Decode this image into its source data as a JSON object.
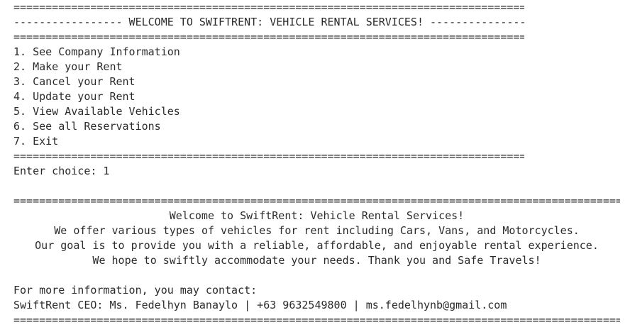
{
  "console": {
    "menu_rule": "================================================================================",
    "menu_title": "----------------- WELCOME TO SWIFTRENT: VEHICLE RENTAL SERVICES! ---------------",
    "menu_items": [
      "1. See Company Information",
      "2. Make your Rent",
      "3. Cancel your Rent",
      "4. Update your Rent",
      "5. View Available Vehicles",
      "6. See all Reservations",
      "7. Exit"
    ],
    "prompt": "Enter choice: 1",
    "info_rule": "================================================================================================",
    "info_lines": [
      "Welcome to SwiftRent: Vehicle Rental Services!",
      "We offer various types of vehicles for rent including Cars, Vans, and Motorcycles.",
      "Our goal is to provide you with a reliable, affordable, and enjoyable rental experience.",
      "We hope to swiftly accommodate your needs. Thank you and Safe Travels!"
    ],
    "contact_heading": "For more information, you may contact:",
    "contact_line": "SwiftRent CEO: Ms. Fedelhyn Banaylo | +63 9632549800 | ms.fedelhynb@gmail.com"
  }
}
